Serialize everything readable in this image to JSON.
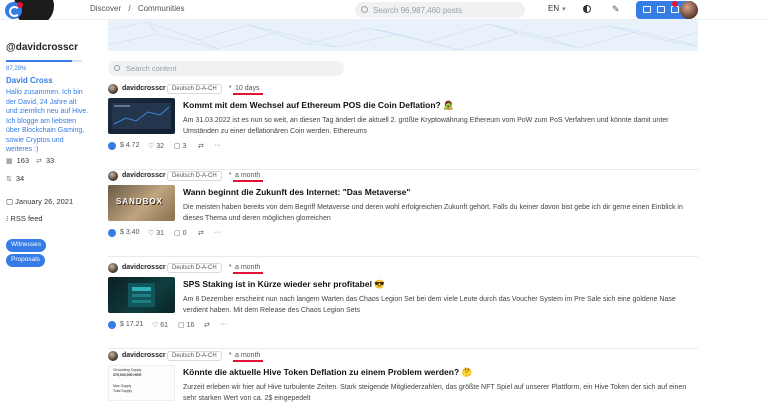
{
  "topbar": {
    "breadcrumb": [
      "Discover",
      "/",
      "Communities"
    ],
    "search_placeholder": "Search 96,987,460 posts",
    "language": "EN"
  },
  "profile": {
    "handle": "@davidcrosscr",
    "reputation_pct": "87.29%",
    "reputation_fraction": 0.8729,
    "name": "David Cross",
    "bio": "Hallo zusammen. Ich bin der David, 24 Jahre alt und ziemlich neu auf Hive. Ich blogge am liebsten über Blockchain Gaming, sowie Cryptos und weiteres :)",
    "followers": "163",
    "following": "33",
    "posts": "34",
    "joined": "January 26, 2021",
    "rss": "RSS feed",
    "buttons": [
      "Witnesses",
      "Proposals"
    ]
  },
  "content_search_placeholder": "Search content",
  "posts": [
    {
      "author": "davidcrosscr",
      "community": "Deutsch D-A-CH",
      "time": "10 days",
      "title": "Kommt mit dem Wechsel auf Ethereum POS die Coin Deflation? 🧟",
      "summary": "Am 31.03.2022 ist es nun so weit, an diesen Tag ändert die aktuell 2. größte Kryptowährung Ethereum vom PoW zum PoS Verfahren und könnte damit unter Umständen zu einer deflationären Coin werden. Ethereums",
      "payout": "$ 4.72",
      "votes": "32",
      "comments": "3",
      "thumb_color": "#1c2a3d"
    },
    {
      "author": "davidcrosscr",
      "community": "Deutsch D-A-CH",
      "time": "a month",
      "title": "Wann beginnt die Zukunft des Internet: \"Das Metaverse\"",
      "summary": "Die meisten haben bereits von dem Begriff Metaverse und deren wohl erfolgreichen Zukunft gehört. Falls du keiner davon bist gebe ich dir gerne einen Einblick in dieses Thema und deren möglichen glorreichen",
      "payout": "$ 3.40",
      "votes": "31",
      "comments": "0",
      "thumb_label": "SANDBOX",
      "thumb_color": "#bfa57f"
    },
    {
      "author": "davidcrosscr",
      "community": "Deutsch D-A-CH",
      "time": "a month",
      "title": "SPS Staking ist in Kürze wieder sehr profitabel 😎",
      "summary": "Am 8 Dezember erscheint nun nach langem Warten das Chaos Legion Set bei dem viele Leute durch das Voucher System im Pre Sale sich eine goldene Nase verdient haben. Mit dem Release des Chaos Legion Sets",
      "payout": "$ 17.21",
      "votes": "61",
      "comments": "16",
      "thumb_color": "#0f3d3f"
    },
    {
      "author": "davidcrosscr",
      "community": "Deutsch D-A-CH",
      "time": "a month",
      "title": "Könnte die aktuelle Hive Token Deflation zu einem Problem werden? 🤔",
      "summary": "Zurzeit erleben wir hier auf Hive turbulente Zeiten. Stark steigende Mitgliederzahlen, das größte NFT Spiel auf unserer Plattform, ein Hive Token der sich auf einen sehr starken Wert von ca. 2$ eingepedelt",
      "thumb_lines": [
        "Circulating Supply",
        "379,000,000 HIVE",
        "Max Supply",
        "Total Supply"
      ],
      "thumb_color": "#fdfdfd"
    }
  ],
  "colors": {
    "accent": "#357ce6",
    "highlight": "#e31337"
  }
}
